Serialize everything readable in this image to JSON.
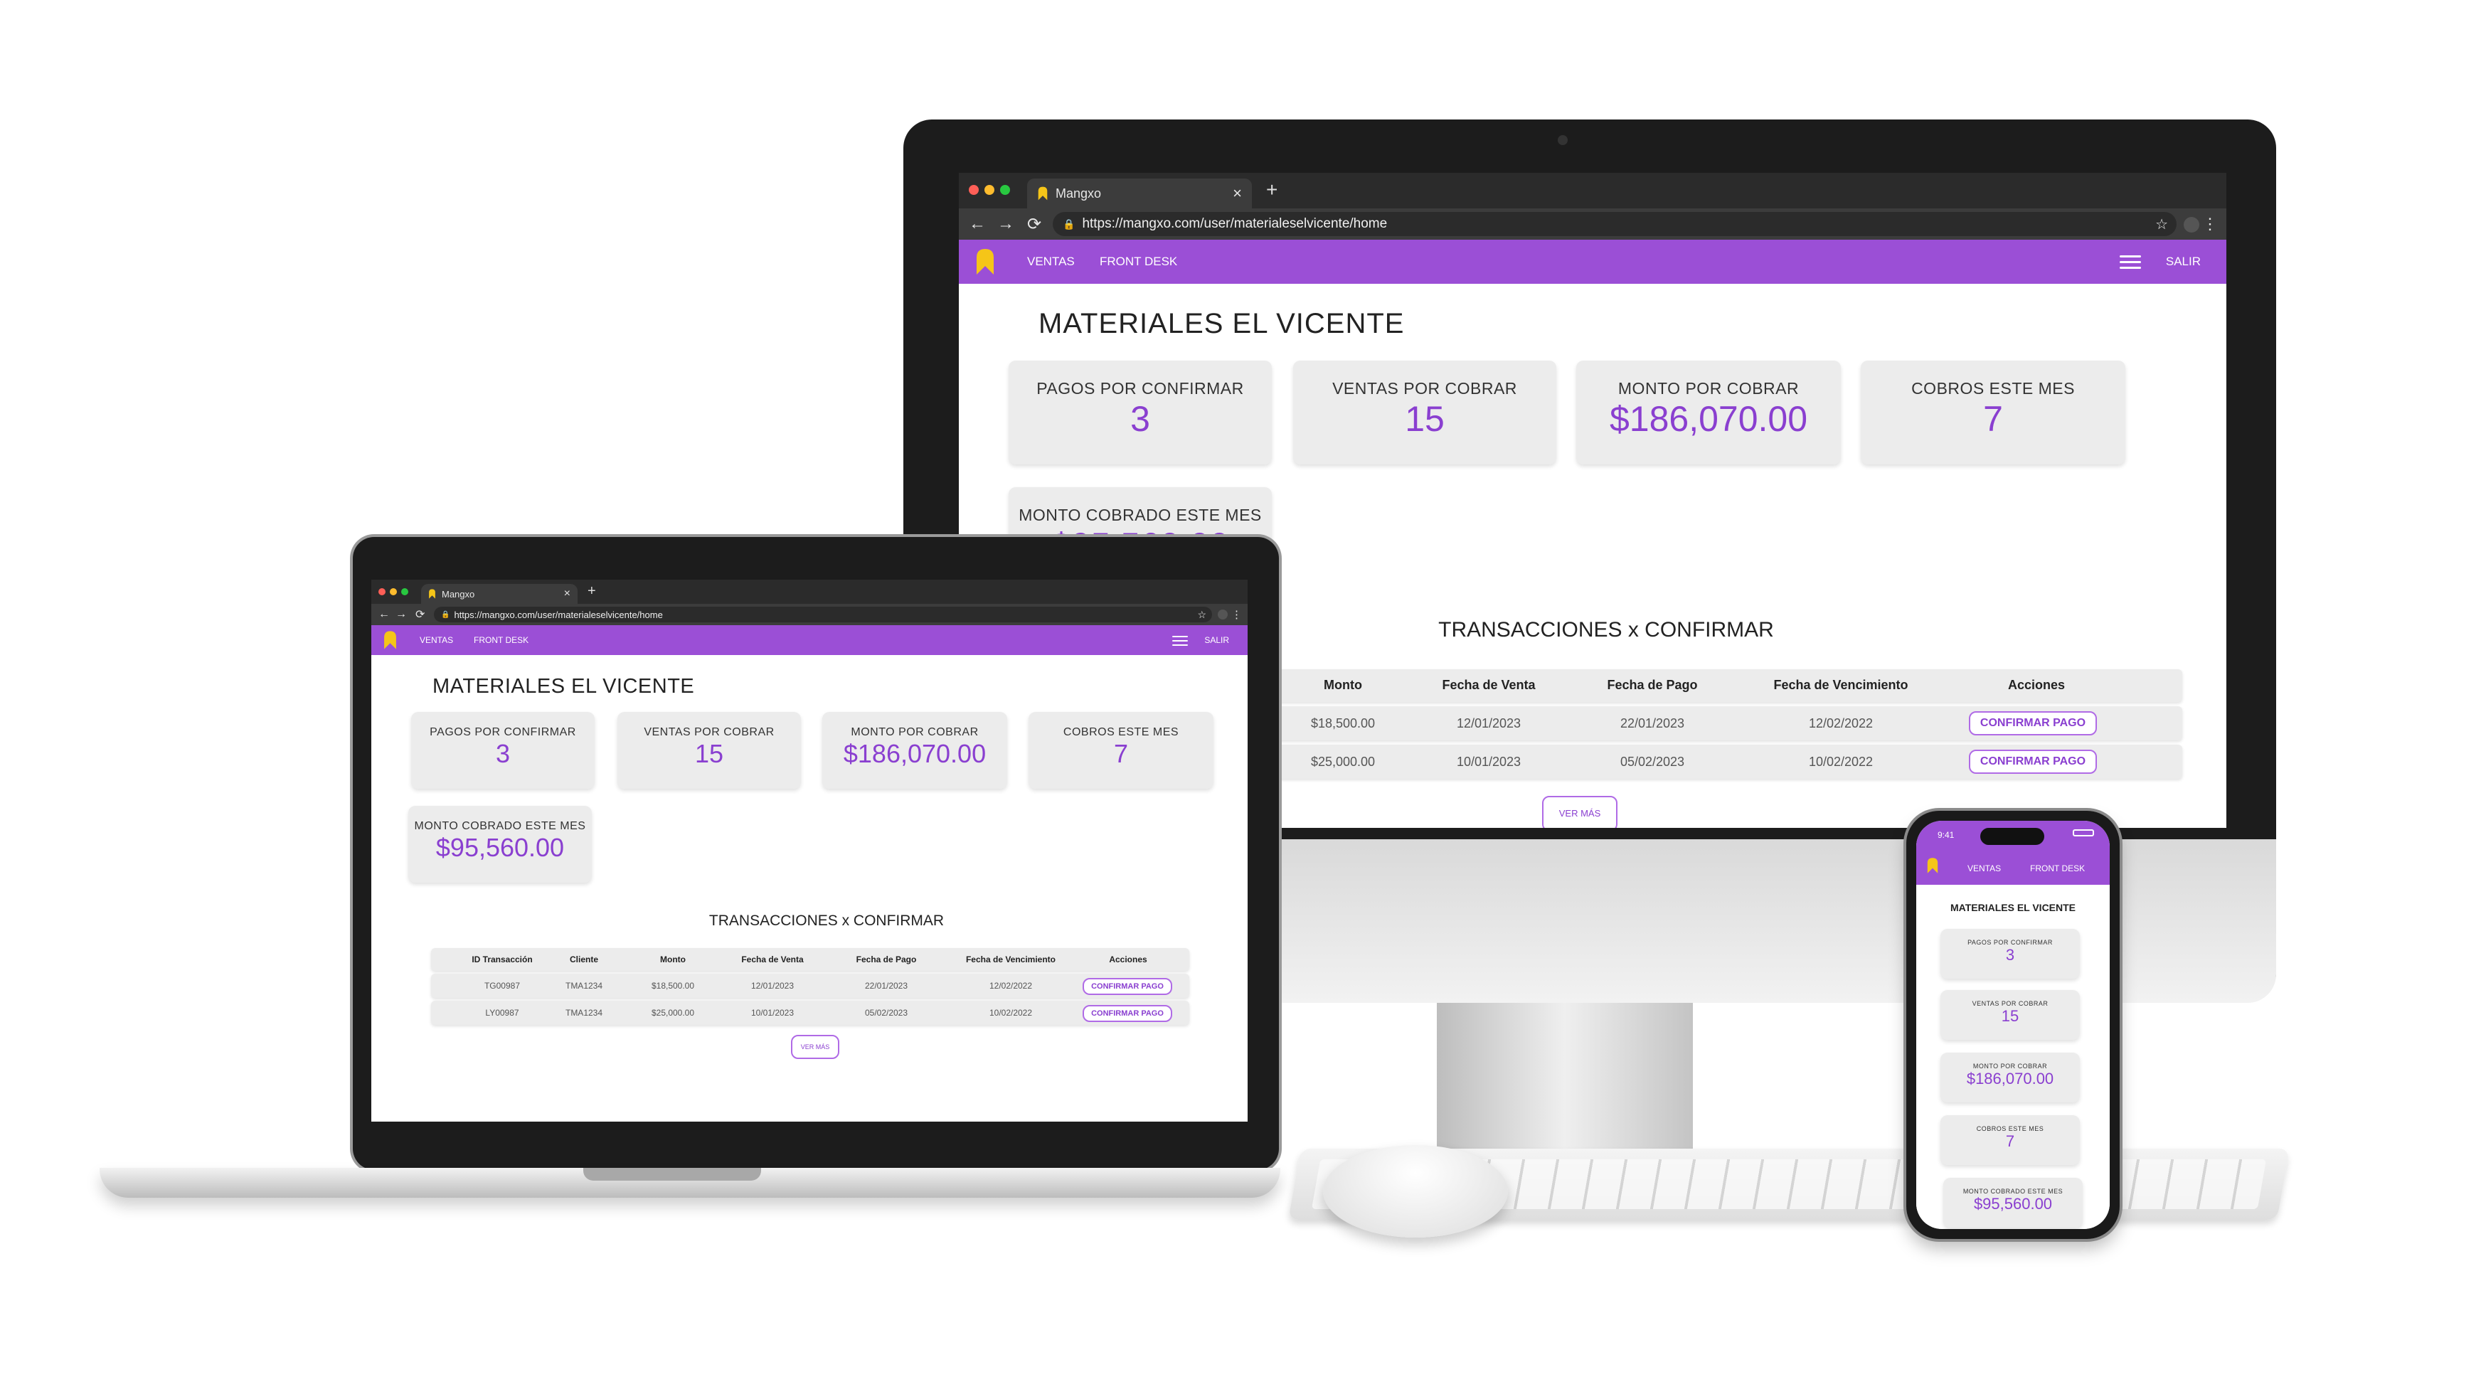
{
  "browser": {
    "tab_title": "Mangxo",
    "new_tab": "+",
    "tab_close": "×",
    "url": "https://mangxo.com/user/materialeselvicente/home"
  },
  "nav": {
    "ventas": "VENTAS",
    "front_desk": "FRONT DESK",
    "salir": "SALIR"
  },
  "page": {
    "title": "MATERIALES EL VICENTE",
    "cards": [
      {
        "label": "PAGOS POR CONFIRMAR",
        "value": "3"
      },
      {
        "label": "VENTAS POR COBRAR",
        "value": "15"
      },
      {
        "label": "MONTO POR COBRAR",
        "value": "$186,070.00"
      },
      {
        "label": "COBROS ESTE MES",
        "value": "7"
      },
      {
        "label": "MONTO COBRADO ESTE MES",
        "value": "$95,560.00"
      }
    ],
    "table_title": "TRANSACCIONES x CONFIRMAR",
    "table_headers": [
      "ID Transacción",
      "Cliente",
      "Monto",
      "Fecha de Venta",
      "Fecha de Pago",
      "Fecha de Vencimiento",
      "Acciones"
    ],
    "rows": [
      {
        "id": "TG00987",
        "cliente": "TMA1234",
        "monto": "$18,500.00",
        "venta": "12/01/2023",
        "pago": "22/01/2023",
        "vencimiento": "12/02/2022",
        "accion": "CONFIRMAR PAGO"
      },
      {
        "id": "LY00987",
        "cliente": "TMA1234",
        "monto": "$25,000.00",
        "venta": "10/01/2023",
        "pago": "05/02/2023",
        "vencimiento": "10/02/2022",
        "accion": "CONFIRMAR PAGO"
      }
    ],
    "ver_mas": "VER MÁS"
  },
  "phone": {
    "time": "9:41"
  },
  "colors": {
    "accent": "#9b4fd6",
    "value_text": "#8a3fd0",
    "logo": "#f5c518",
    "card_bg": "#ececec"
  }
}
